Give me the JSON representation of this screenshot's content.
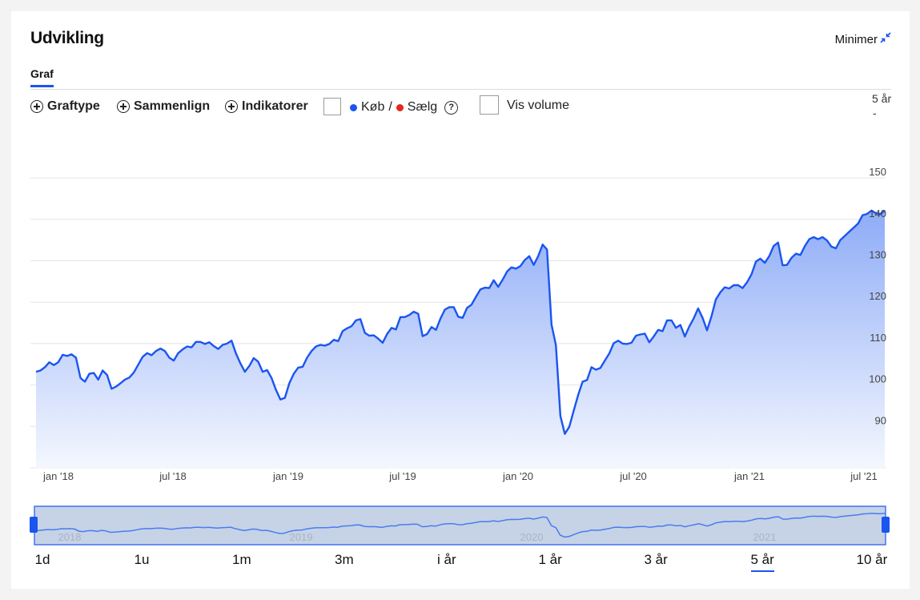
{
  "header": {
    "title": "Udvikling",
    "minimize_label": "Minimer"
  },
  "tabs": [
    {
      "label": "Graf",
      "active": true
    }
  ],
  "toolbar": {
    "graph_type": "Graftype",
    "compare": "Sammenlign",
    "indicators": "Indikatorer",
    "buy_label": "Køb",
    "separator": "/",
    "sell_label": "Sælg",
    "help": "?",
    "volume_label": "Vis volume",
    "period_label": "5 år",
    "period_dash": "-"
  },
  "colors": {
    "accent": "#1a55f0",
    "buy": "#1a55f0",
    "sell": "#e5261f",
    "area_top": "#8eacf7",
    "area_bottom": "#f4f7fe"
  },
  "range_buttons": [
    {
      "label": "1d",
      "active": false
    },
    {
      "label": "1u",
      "active": false
    },
    {
      "label": "1m",
      "active": false
    },
    {
      "label": "3m",
      "active": false
    },
    {
      "label": "i år",
      "active": false
    },
    {
      "label": "1 år",
      "active": false
    },
    {
      "label": "3 år",
      "active": false
    },
    {
      "label": "5 år",
      "active": true
    },
    {
      "label": "10 år",
      "active": false
    }
  ],
  "navigator": {
    "year_labels": [
      "2018",
      "2019",
      "2020",
      "2021"
    ]
  },
  "chart_data": {
    "type": "area",
    "x_tick_labels": [
      "jan '18",
      "jul '18",
      "jan '19",
      "jul '19",
      "jan '20",
      "jul '20",
      "jan '21",
      "jul '21"
    ],
    "y_ticks": [
      90,
      100,
      110,
      120,
      130,
      140,
      150
    ],
    "ylim": [
      80,
      155
    ],
    "grid": true,
    "series": [
      {
        "values": [
          103.2,
          103.5,
          104.3,
          105.5,
          104.8,
          105.5,
          107.3,
          107.0,
          107.4,
          106.6,
          101.7,
          100.8,
          102.7,
          102.9,
          101.3,
          103.5,
          102.4,
          99.1,
          99.6,
          100.4,
          101.3,
          101.8,
          103.0,
          104.9,
          106.8,
          107.7,
          107.2,
          108.2,
          108.8,
          108.2,
          106.6,
          105.9,
          107.7,
          108.6,
          109.3,
          109.1,
          110.4,
          110.4,
          109.9,
          110.3,
          109.4,
          108.7,
          109.7,
          110.0,
          110.7,
          107.6,
          105.2,
          103.2,
          104.6,
          106.5,
          105.6,
          103.2,
          103.6,
          101.7,
          98.8,
          96.5,
          96.9,
          100.4,
          102.7,
          104.2,
          104.4,
          106.6,
          108.2,
          109.3,
          109.7,
          109.5,
          109.9,
          110.9,
          110.6,
          113.0,
          113.7,
          114.2,
          115.6,
          115.9,
          112.6,
          111.9,
          112.0,
          111.2,
          110.2,
          112.3,
          113.8,
          113.4,
          116.4,
          116.4,
          116.9,
          117.7,
          117.2,
          111.8,
          112.3,
          114.0,
          113.3,
          116.0,
          118.2,
          118.8,
          118.8,
          116.5,
          116.2,
          118.6,
          119.4,
          121.3,
          123.1,
          123.5,
          123.4,
          125.3,
          123.7,
          125.4,
          127.4,
          128.4,
          128.1,
          128.7,
          130.2,
          131.1,
          129.0,
          131.1,
          133.9,
          132.7,
          114.6,
          109.6,
          92.5,
          88.2,
          89.9,
          93.8,
          97.6,
          100.8,
          101.2,
          104.3,
          103.7,
          104.1,
          105.9,
          107.6,
          110.1,
          110.7,
          110.0,
          109.9,
          110.2,
          111.9,
          112.2,
          112.4,
          110.3,
          111.7,
          113.3,
          113.0,
          115.6,
          115.6,
          113.8,
          114.5,
          111.7,
          114.1,
          116.1,
          118.5,
          116.2,
          113.2,
          116.6,
          120.7,
          122.4,
          123.6,
          123.3,
          124.1,
          124.1,
          123.4,
          124.8,
          126.7,
          129.8,
          130.5,
          129.5,
          131.1,
          133.6,
          134.4,
          128.9,
          129.0,
          130.7,
          131.7,
          131.4,
          133.5,
          135.2,
          135.7,
          135.2,
          135.7,
          134.9,
          133.4,
          133.0,
          135.0,
          136.0,
          137.0,
          138.0,
          139.0,
          141.0,
          141.3,
          142.1,
          141.5,
          141.3,
          142.1
        ]
      }
    ]
  }
}
